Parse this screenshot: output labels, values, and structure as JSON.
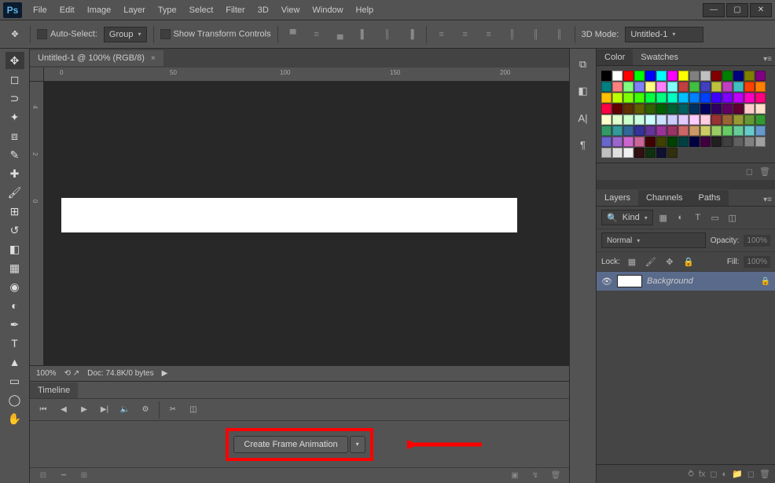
{
  "app": {
    "logo": "Ps"
  },
  "menu": [
    "File",
    "Edit",
    "Image",
    "Layer",
    "Type",
    "Select",
    "Filter",
    "3D",
    "View",
    "Window",
    "Help"
  ],
  "options_bar": {
    "auto_select_label": "Auto-Select:",
    "auto_select_value": "Group",
    "show_transform_label": "Show Transform Controls",
    "mode_3d_label": "3D Mode:",
    "doc_dropdown": "Untitled-1"
  },
  "document": {
    "tab_title": "Untitled-1 @ 100% (RGB/8)",
    "zoom": "100%",
    "doc_info": "Doc: 74.8K/0 bytes"
  },
  "ruler_h": [
    "0",
    "50",
    "100",
    "150",
    "200"
  ],
  "ruler_v": [
    "4",
    "2",
    "0"
  ],
  "timeline": {
    "tab": "Timeline",
    "create_btn": "Create Frame Animation"
  },
  "swatches": {
    "tab_color": "Color",
    "tab_swatches": "Swatches",
    "colors": [
      "#000000",
      "#ffffff",
      "#ff0000",
      "#00ff00",
      "#0000ff",
      "#00ffff",
      "#ff00ff",
      "#ffff00",
      "#808080",
      "#c0c0c0",
      "#800000",
      "#008000",
      "#000080",
      "#808000",
      "#800080",
      "#008080",
      "#ff8080",
      "#80ff80",
      "#8080ff",
      "#ffff80",
      "#ff80ff",
      "#80ffff",
      "#c04040",
      "#40c040",
      "#4040c0",
      "#c0c040",
      "#c040c0",
      "#40c0c0",
      "#ff4000",
      "#ff8000",
      "#ffc000",
      "#c0ff00",
      "#80ff00",
      "#40ff00",
      "#00ff40",
      "#00ff80",
      "#00ffc0",
      "#00c0ff",
      "#0080ff",
      "#0040ff",
      "#4000ff",
      "#8000ff",
      "#c000ff",
      "#ff00c0",
      "#ff0080",
      "#ff0040",
      "#600000",
      "#603000",
      "#606000",
      "#306000",
      "#006000",
      "#006030",
      "#006060",
      "#003060",
      "#000060",
      "#300060",
      "#600060",
      "#600030",
      "#ffcccc",
      "#ffe0cc",
      "#ffffcc",
      "#e0ffcc",
      "#ccffcc",
      "#ccffe0",
      "#ccffff",
      "#cce0ff",
      "#ccccff",
      "#e0ccff",
      "#ffccff",
      "#ffcce0",
      "#993333",
      "#996633",
      "#999933",
      "#669933",
      "#339933",
      "#339966",
      "#339999",
      "#336699",
      "#333399",
      "#663399",
      "#993399",
      "#993366",
      "#cc6666",
      "#cc9966",
      "#cccc66",
      "#99cc66",
      "#66cc66",
      "#66cc99",
      "#66cccc",
      "#6699cc",
      "#6666cc",
      "#9966cc",
      "#cc66cc",
      "#cc6699",
      "#400000",
      "#404000",
      "#004000",
      "#004040",
      "#000040",
      "#400040",
      "#202020",
      "#404040",
      "#606060",
      "#808080",
      "#a0a0a0",
      "#c0c0c0",
      "#e0e0e0",
      "#f0f0f0",
      "#301010",
      "#103010",
      "#101030",
      "#303010"
    ]
  },
  "layers": {
    "tab_layers": "Layers",
    "tab_channels": "Channels",
    "tab_paths": "Paths",
    "kind_label": "Kind",
    "blend_mode": "Normal",
    "opacity_label": "Opacity:",
    "opacity_value": "100%",
    "lock_label": "Lock:",
    "fill_label": "Fill:",
    "fill_value": "100%",
    "bg_layer": "Background"
  }
}
